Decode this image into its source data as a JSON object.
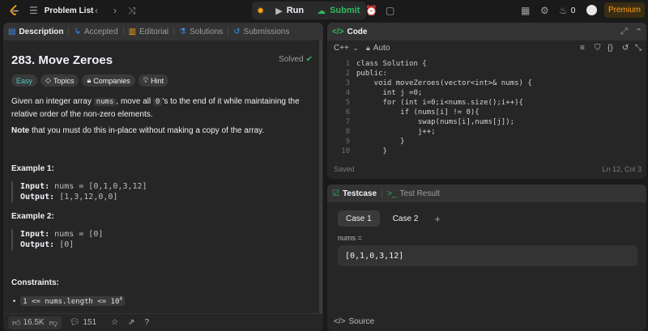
{
  "topbar": {
    "problem_list": "Problem List",
    "run": "Run",
    "submit": "Submit",
    "streak_count": "0",
    "premium": "Premium"
  },
  "left_tabs": [
    {
      "label": "Description",
      "icon": "description-icon"
    },
    {
      "label": "Accepted",
      "icon": "accepted-icon"
    },
    {
      "label": "Editorial",
      "icon": "editorial-icon"
    },
    {
      "label": "Solutions",
      "icon": "solutions-icon"
    },
    {
      "label": "Submissions",
      "icon": "submissions-icon"
    }
  ],
  "problem": {
    "title": "283. Move Zeroes",
    "status": "Solved",
    "difficulty": "Easy",
    "topics": "Topics",
    "companies": "Companies",
    "hint": "Hint",
    "desc_pre": "Given an integer array ",
    "desc_code1": "nums",
    "desc_mid": ", move all ",
    "desc_code2": "0",
    "desc_post": "'s to the end of it while maintaining the relative order of the non-zero elements.",
    "note_bold": "Note",
    "note_rest": " that you must do this in-place without making a copy of the array.",
    "example1_title": "Example 1:",
    "example1_input_label": "Input:",
    "example1_input": "nums = [0,1,0,3,12]",
    "example1_output_label": "Output:",
    "example1_output": "[1,3,12,0,0]",
    "example2_title": "Example 2:",
    "example2_input_label": "Input:",
    "example2_input": "nums = [0]",
    "example2_output_label": "Output:",
    "example2_output": "[0]",
    "constraints_title": "Constraints:",
    "constraint1": "1 <= nums.length <= 10",
    "constraint1_sup": "4"
  },
  "bottombar": {
    "likes": "16.5K",
    "comments": "151"
  },
  "code_panel": {
    "title": "Code",
    "language": "C++",
    "mode": "Auto",
    "saved": "Saved",
    "cursor": "Ln 12, Col 3"
  },
  "code_lines": [
    "class Solution {",
    "public:",
    "    void moveZeroes(vector<int>& nums) {",
    "      int j =0;",
    "      for (int i=0;i<nums.size();i++){",
    "          if (nums[i] != 0){",
    "              swap(nums[i],nums[j]);",
    "              j++;",
    "          }",
    "      }"
  ],
  "test_panel": {
    "testcase_tab": "Testcase",
    "result_tab": "Test Result",
    "case1": "Case 1",
    "case2": "Case 2",
    "add": "+",
    "nums_label": "nums =",
    "nums_value": "[0,1,0,3,12]",
    "source": "Source"
  },
  "colors": {
    "accent": "#ffa116",
    "green": "#2cbb5d",
    "easy": "#46c6c2"
  }
}
